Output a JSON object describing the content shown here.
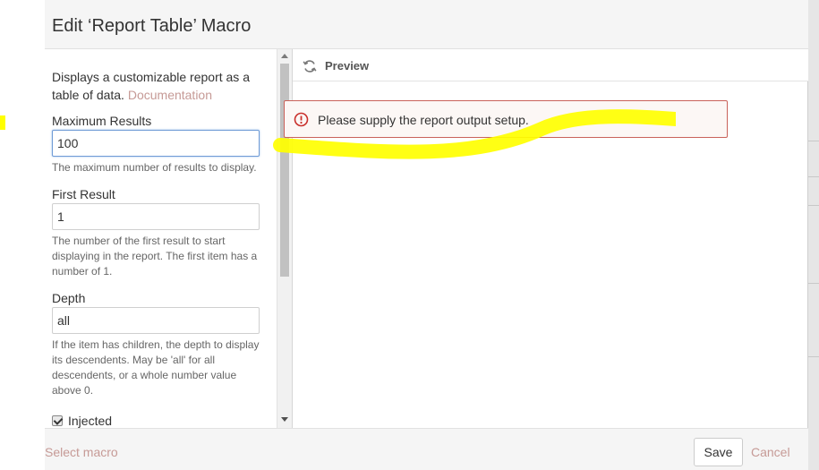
{
  "dialog": {
    "title": "Edit ‘Report Table’ Macro"
  },
  "settings": {
    "description": "Displays a customizable report as a table of data.",
    "documentation_link": "Documentation",
    "fields": [
      {
        "label": "Maximum Results",
        "value": "100",
        "help": "The maximum number of results to display."
      },
      {
        "label": "First Result",
        "value": "1",
        "help": "The number of the first result to start displaying in the report. The first item has a number of 1."
      },
      {
        "label": "Depth",
        "value": "all",
        "help": "If the item has children, the depth to display its descendents. May be 'all' for all descendents, or a whole number value above 0."
      }
    ],
    "injected": {
      "label": "Injected",
      "checked": true
    }
  },
  "preview": {
    "title": "Preview",
    "error_message": "Please supply the report output setup."
  },
  "footer": {
    "select_macro": "Select macro",
    "save": "Save",
    "cancel": "Cancel"
  },
  "colors": {
    "link": "#c69a96",
    "error_border": "#c9625a",
    "error_bg": "#fcf7f5",
    "focus_border": "#6f9bd6",
    "highlight": "#ffff00"
  },
  "icons": [
    "refresh-icon",
    "error-circle-icon",
    "checkbox-checked-icon",
    "scroll-up-arrow",
    "scroll-down-arrow"
  ]
}
